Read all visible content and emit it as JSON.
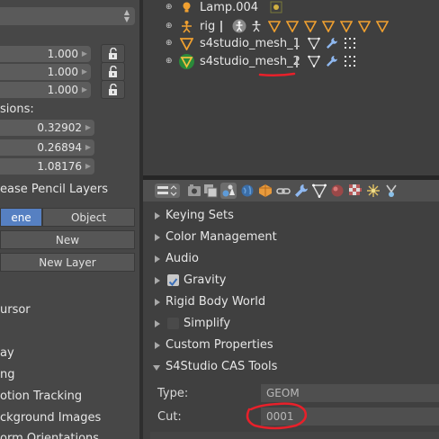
{
  "left": {
    "fields": [
      "1.000",
      "1.000",
      "1.000"
    ],
    "dimensions_label": "sions:",
    "dimensions": [
      "0.32902",
      "0.26894",
      "1.08176"
    ],
    "grease_pencil_header": "ease Pencil Layers",
    "scene_tab": "ene",
    "object_tab": "Object",
    "new_button": "New",
    "new_layer_button": "New Layer",
    "sections": [
      "ursor",
      "ay",
      "ng",
      "otion Tracking",
      "ckground Images",
      "orm Orientations"
    ]
  },
  "outliner": {
    "rows": [
      {
        "name": "Lamp.004",
        "icon": "lamp-icon"
      },
      {
        "name": "rig",
        "icon": "armature-icon"
      },
      {
        "name": "s4studio_mesh_1",
        "icon": "mesh-icon"
      },
      {
        "name": "s4studio_mesh_2",
        "icon": "mesh-icon",
        "active": true
      }
    ]
  },
  "properties": {
    "panels": [
      {
        "label": "Keying Sets",
        "expanded": false
      },
      {
        "label": "Color Management",
        "expanded": false
      },
      {
        "label": "Audio",
        "expanded": false
      },
      {
        "label": "Gravity",
        "expanded": false,
        "checkbox": true,
        "checked": true
      },
      {
        "label": "Rigid Body World",
        "expanded": false
      },
      {
        "label": "Simplify",
        "expanded": false,
        "checkbox": true,
        "checked": false
      },
      {
        "label": "Custom Properties",
        "expanded": false
      },
      {
        "label": "S4Studio CAS Tools",
        "expanded": true
      }
    ],
    "type_label": "Type:",
    "type_value": "GEOM",
    "cut_label": "Cut:",
    "cut_value": "0001"
  },
  "colors": {
    "accent_blue": "#5680c2",
    "annotation_red": "#e8202a",
    "mesh_orange": "#f0a030",
    "active_green": "#2a8a3a"
  }
}
